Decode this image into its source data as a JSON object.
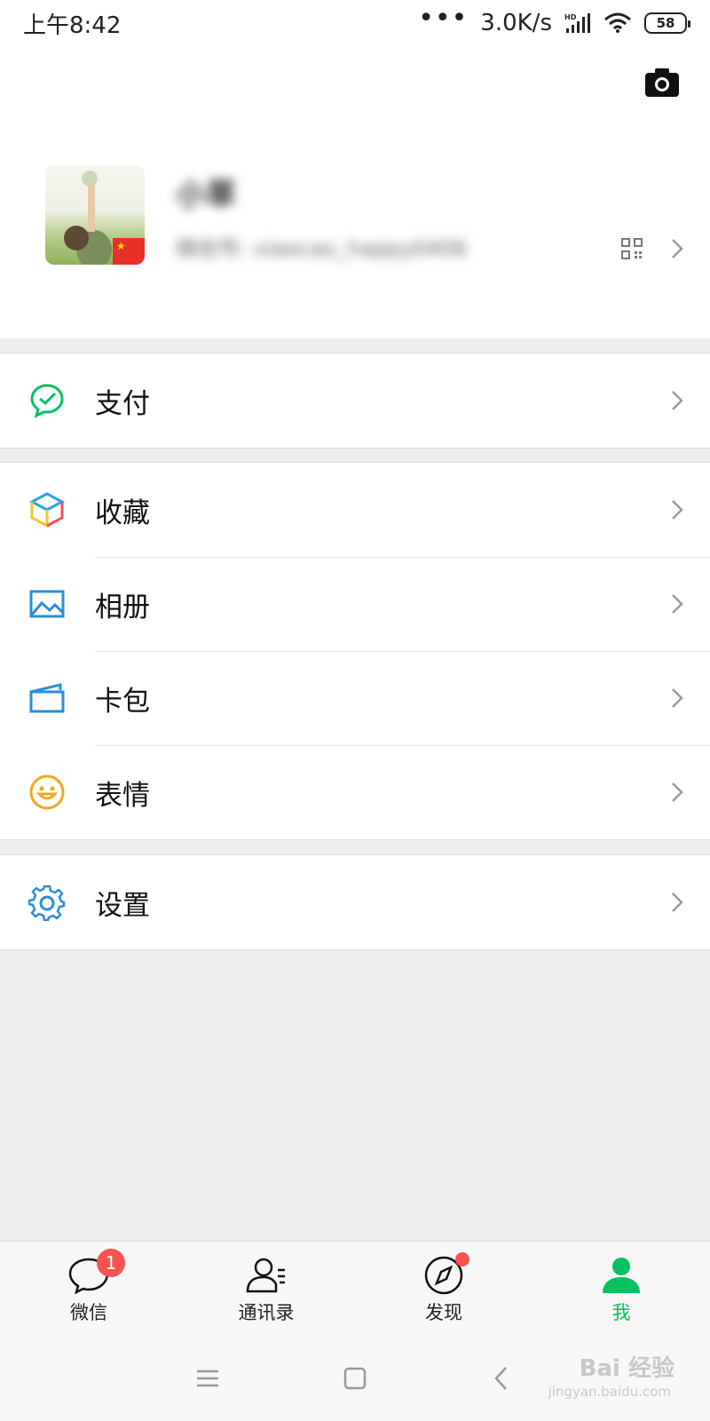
{
  "status_bar": {
    "time": "上午8:42",
    "dots": "•••",
    "network_speed": "3.0K/s",
    "battery": "58"
  },
  "profile": {
    "nickname": "小草",
    "wechat_id": "微信号: xiaocao_happy0406"
  },
  "menu_groups": [
    [
      {
        "label": "支付",
        "icon": "wechat-pay-icon"
      }
    ],
    [
      {
        "label": "收藏",
        "icon": "favorites-cube-icon"
      },
      {
        "label": "相册",
        "icon": "album-icon"
      },
      {
        "label": "卡包",
        "icon": "card-wallet-icon"
      },
      {
        "label": "表情",
        "icon": "sticker-smile-icon"
      }
    ],
    [
      {
        "label": "设置",
        "icon": "settings-gear-icon"
      }
    ]
  ],
  "tabbar": {
    "tabs": [
      {
        "label": "微信",
        "badge": "1",
        "icon": "chat-icon"
      },
      {
        "label": "通讯录",
        "icon": "contacts-icon"
      },
      {
        "label": "发现",
        "icon": "compass-icon"
      },
      {
        "label": "我",
        "icon": "me-icon",
        "active": true
      }
    ]
  },
  "watermark": {
    "text": "Bai 经验",
    "sub": "jingyan.baidu.com"
  },
  "colors": {
    "accent": "#07c160",
    "badge": "#fa5151",
    "background": "#ededed"
  }
}
